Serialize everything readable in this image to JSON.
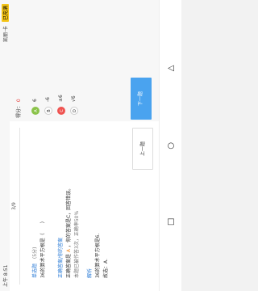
{
  "status": {
    "time": "上午 8:51",
    "battery_badge": "已充满",
    "right_text": "凯丽·卡"
  },
  "question": {
    "counter": "3/9",
    "type_label": "单选题",
    "type_tag": "(5分)",
    "text": "36的算术平方根是（　　）",
    "hint_label": "正确答案/你的答案",
    "line1_prefix": "正确答案是",
    "line1_highlight": "A",
    "line1_mid": "，你的答案是C，回答错误。",
    "line2": "本题已被作答3次，正确率50%"
  },
  "analysis": {
    "title": "解析",
    "text": "36的算术平方根是6.",
    "answer": "故选：A."
  },
  "score": {
    "label": "得分：",
    "value": "0"
  },
  "options": [
    {
      "letter": "A",
      "text": "6",
      "state": "correct"
    },
    {
      "letter": "B",
      "text": "-6",
      "state": "normal"
    },
    {
      "letter": "C",
      "text": "±6",
      "state": "wrong"
    },
    {
      "letter": "D",
      "text": "√6",
      "state": "normal"
    }
  ],
  "buttons": {
    "next": "下一题",
    "prev": "上一题"
  },
  "navbar": {
    "back_icon": "back-icon",
    "home_icon": "home-icon",
    "recent_icon": "recent-apps-icon"
  }
}
